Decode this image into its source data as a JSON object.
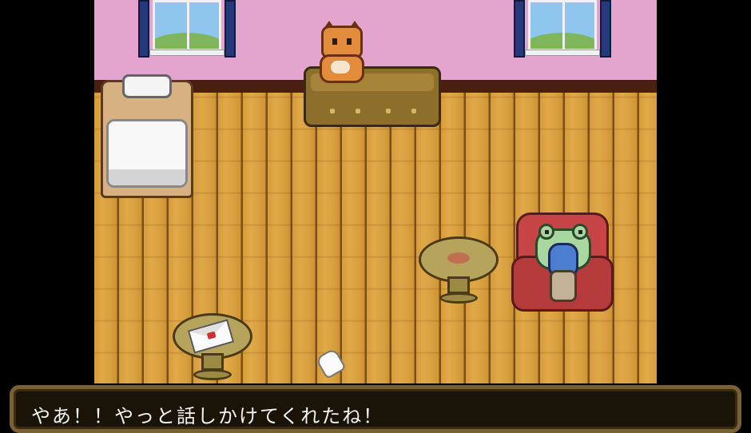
{
  "scene": {
    "room": "bedroom",
    "objects": [
      "window-left",
      "window-right",
      "bed",
      "cabinet",
      "cat",
      "round-table",
      "small-table-with-letter",
      "armchair",
      "frog-hood-character",
      "glove"
    ]
  },
  "dialog": {
    "text": "やあ！！やっと話しかけてくれたね！"
  },
  "colors": {
    "wall": "#e3a5cd",
    "floor": "#d69c3a",
    "dialog_border": "#7a6032",
    "dialog_bg": "#1a1408"
  }
}
